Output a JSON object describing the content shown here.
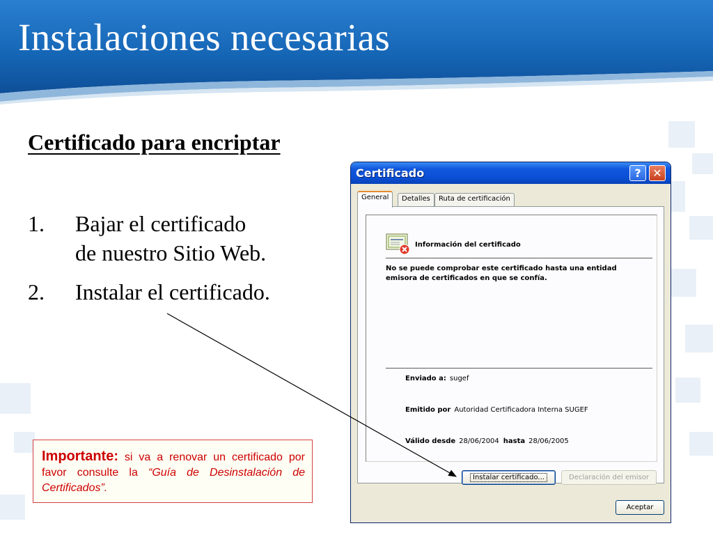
{
  "slide": {
    "title": "Instalaciones necesarias",
    "subtitle": "Certificado para encriptar",
    "steps": [
      {
        "num": "1.",
        "line1": "Bajar el certificado",
        "line2": "de nuestro Sitio Web."
      },
      {
        "num": "2.",
        "line1": "Instalar el certificado.",
        "line2": ""
      }
    ],
    "important": {
      "label": "Importante:",
      "text": " si va a renovar un certificado por favor consulte la ",
      "italic": "“Guía de Desinstalación de Certificados”."
    }
  },
  "dialog": {
    "title": "Certificado",
    "help_label": "?",
    "close_label": "✕",
    "tabs": [
      "General",
      "Detalles",
      "Ruta de certificación"
    ],
    "info_heading": "Información del certificado",
    "warning": "No se puede comprobar este certificado hasta una entidad emisora de certificados en que se confía.",
    "issued_to_label": "Enviado a:",
    "issued_to_value": "sugef",
    "issued_by_label": "Emitido por",
    "issued_by_value": "Autoridad Certificadora Interna SUGEF",
    "valid_from_label": "Válido desde",
    "valid_from_value": "28/06/2004",
    "valid_to_label": "hasta",
    "valid_to_value": "28/06/2005",
    "install_button": "Instalar certificado...",
    "statement_button": "Declaración del emisor",
    "ok_button": "Aceptar"
  },
  "colors": {
    "header_blue": "#1565b5",
    "important_red": "#cc0000",
    "xp_title_blue": "#0b4fd6"
  }
}
